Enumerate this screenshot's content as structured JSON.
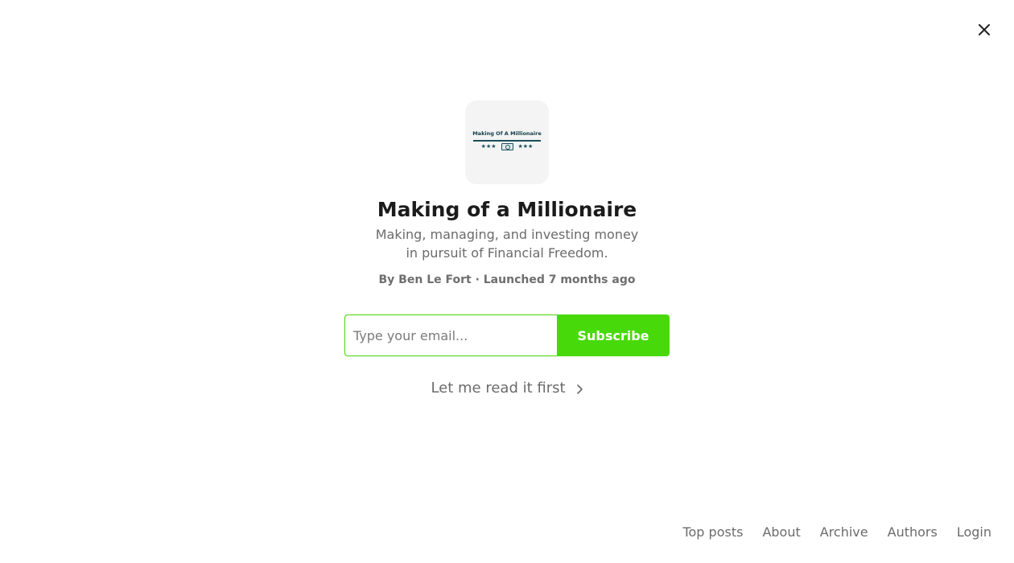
{
  "publication": {
    "logo_text": "Making Of A Millionaire",
    "title": "Making of a Millionaire",
    "subtitle": "Making, managing, and investing money in pursuit of Financial Freedom.",
    "byline": "By Ben Le Fort · Launched 7 months ago"
  },
  "subscribe_form": {
    "email_placeholder": "Type your email...",
    "email_value": "",
    "button_label": "Subscribe",
    "accent_color": "#48d90a"
  },
  "read_first": {
    "label": "Let me read it first",
    "icon": "chevron-right-icon"
  },
  "close": {
    "icon": "close-icon"
  },
  "footer": {
    "links": [
      {
        "label": "Top posts"
      },
      {
        "label": "About"
      },
      {
        "label": "Archive"
      },
      {
        "label": "Authors"
      },
      {
        "label": "Login"
      }
    ]
  }
}
